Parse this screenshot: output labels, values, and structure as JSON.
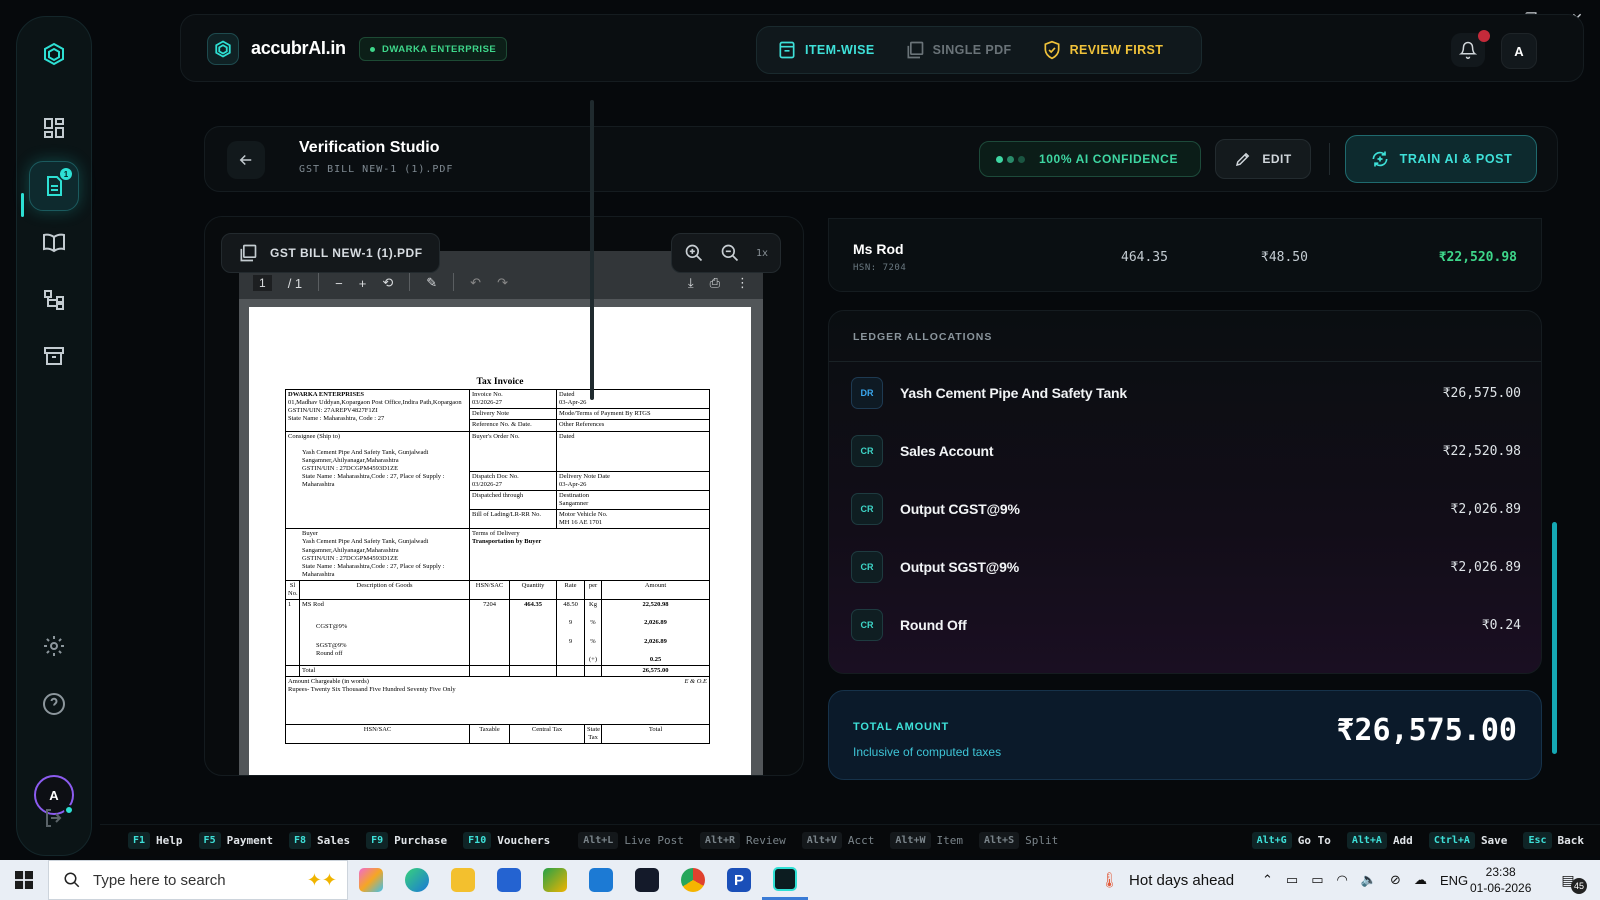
{
  "topbar": {
    "brand": "accubrAI.in",
    "company_badge": "DWARKA ENTERPRISE",
    "modes": [
      {
        "label": "ITEM-WISE",
        "icon": "list-icon",
        "color": "#3ee0d8"
      },
      {
        "label": "SINGLE PDF",
        "icon": "pdf-icon",
        "color": "#6a7378"
      },
      {
        "label": "REVIEW FIRST",
        "icon": "shield-icon",
        "color": "#f0c23a"
      }
    ],
    "user_initial": "A"
  },
  "sidebar": {
    "items": [
      "dashboard-icon",
      "documents-icon",
      "book-icon",
      "hierarchy-icon",
      "archive-icon"
    ],
    "badge": "1",
    "footer": [
      "settings-icon",
      "help-icon"
    ],
    "avatar_initial": "A",
    "logout_icon": "logout-icon"
  },
  "studio": {
    "title": "Verification Studio",
    "subtitle": "GST BILL NEW-1 (1).PDF",
    "confidence": "100% AI CONFIDENCE",
    "edit_label": "EDIT",
    "train_label": "TRAIN AI & POST"
  },
  "pdf": {
    "chip_label": "GST BILL NEW-1 (1).PDF",
    "zoom_level": "1x",
    "page_current": "1",
    "page_total": "/ 1",
    "invoice": {
      "title": "Tax Invoice",
      "seller_name": "DWARKA ENTERPRISES",
      "seller_address": "01,Madhav Uddyan,Kopargaon Post Office,Indira Path,Kopargaon",
      "seller_gstin": "GSTIN/UIN: 27AREPV4827F1ZI",
      "seller_state": "State Name : Maharashtra, Code : 27",
      "invoice_no_label": "Invoice No.",
      "invoice_no": "03/2026-27",
      "dated_label": "Dated",
      "dated": "03-Apr-26",
      "delivery_note": "Delivery Note",
      "mode_terms": "Mode/Terms of Payment By RTGS",
      "reference": "Reference No. & Date.",
      "other_refs": "Other References",
      "consignee_label": "Consignee (Ship to)",
      "consignee_name": "Yash Cement Pipe And Safety Tank, Gunjalwadi",
      "consignee_addr": "Sangamner,Ahilyanagar,Maharashtra",
      "consignee_gstin": "GSTIN/UIN : 27DCGPM4593D1ZE",
      "consignee_state": "State Name : Maharashtra,Code : 27, Place of Supply : Maharashtra",
      "buyers_order": "Buyer's Order No.",
      "dated2": "Dated",
      "dispatch_doc": "Dispatch Doc No.",
      "dispatch_doc_no": "03/2026-27",
      "delivery_note_date": "Delivery Note Date",
      "delivery_note_date_val": "03-Apr-26",
      "dispatched_through": "Dispatched through",
      "destination": "Destination",
      "destination_val": "Sangamner",
      "buyer_label": "Buyer",
      "buyer_name": "Yash Cement Pipe And Safety Tank, Gunjalwadi",
      "buyer_addr": "Sangamner,Ahilyanagar,Maharashtra",
      "buyer_gstin": "GSTIN/UIN : 27DCGPM4593D1ZE",
      "buyer_state": "State Name : Maharashtra,Code : 27, Place of Supply : Maharashtra",
      "bill_of_lading": "Bill of Lading/LR-RR No.",
      "motor_vehicle": "Motor Vehicle No.",
      "motor_vehicle_val": "MH 16 AE 1701",
      "terms_delivery": "Terms of Delivery",
      "terms_delivery_val": "Transportation by Buyer",
      "headers": [
        "Sl No.",
        "Description of Goods",
        "HSN/SAC",
        "Quantity",
        "Rate",
        "per",
        "Amount"
      ],
      "line": {
        "sl": "1",
        "desc": "MS Rod",
        "hsn": "7204",
        "qty": "464.35",
        "rate": "48.50",
        "per": "Kg",
        "amount": "22,520.98"
      },
      "cgst": {
        "label": "CGST@9%",
        "rate": "9",
        "per": "%",
        "amount": "2,026.89"
      },
      "sgst": {
        "label": "SGST@9%",
        "rate": "9",
        "per": "%",
        "amount": "2,026.89"
      },
      "round": {
        "label": "Round off",
        "per": "(+)",
        "amount": "0.25"
      },
      "total_label": "Total",
      "total_amount": "26,575.00",
      "amount_words_label": "Amount Chargeable (in words)",
      "eoe": "E & O.E",
      "amount_words": "Rupees- Twenty Six Thousand Five Hundred Seventy Five Only",
      "footer_cols": [
        "HSN/SAC",
        "Taxable",
        "Central Tax",
        "State Tax",
        "Total"
      ]
    }
  },
  "item": {
    "name": "Ms Rod",
    "hsn": "HSN: 7204",
    "qty": "464.35",
    "rate": "₹48.50",
    "amount": "₹22,520.98"
  },
  "ledger": {
    "heading": "LEDGER ALLOCATIONS",
    "rows": [
      {
        "type": "DR",
        "name": "Yash Cement Pipe And Safety Tank",
        "amount": "₹26,575.00"
      },
      {
        "type": "CR",
        "name": "Sales Account",
        "amount": "₹22,520.98"
      },
      {
        "type": "CR",
        "name": "Output CGST@9%",
        "amount": "₹2,026.89"
      },
      {
        "type": "CR",
        "name": "Output SGST@9%",
        "amount": "₹2,026.89"
      },
      {
        "type": "CR",
        "name": "Round Off",
        "amount": "₹0.24"
      }
    ]
  },
  "total": {
    "label": "TOTAL AMOUNT",
    "sub": "Inclusive of computed taxes",
    "amount": "₹26,575.00"
  },
  "shortcuts": {
    "left": [
      {
        "key": "F1",
        "label": "Help"
      },
      {
        "key": "F5",
        "label": "Payment"
      },
      {
        "key": "F8",
        "label": "Sales"
      },
      {
        "key": "F9",
        "label": "Purchase"
      },
      {
        "key": "F10",
        "label": "Vouchers"
      },
      {
        "key": "Alt+L",
        "label": "Live Post",
        "dim": true
      },
      {
        "key": "Alt+R",
        "label": "Review",
        "dim": true
      },
      {
        "key": "Alt+V",
        "label": "Acct",
        "dim": true
      },
      {
        "key": "Alt+W",
        "label": "Item",
        "dim": true
      },
      {
        "key": "Alt+S",
        "label": "Split",
        "dim": true
      }
    ],
    "right": [
      {
        "key": "Alt+G",
        "label": "Go To"
      },
      {
        "key": "Alt+A",
        "label": "Add"
      },
      {
        "key": "Ctrl+A",
        "label": "Save"
      },
      {
        "key": "Esc",
        "label": "Back"
      }
    ]
  },
  "taskbar": {
    "search_placeholder": "Type here to search",
    "weather": "Hot days ahead",
    "lang": "ENG",
    "time": "23:38",
    "date": "01-06-2026",
    "notif_count": "45"
  }
}
